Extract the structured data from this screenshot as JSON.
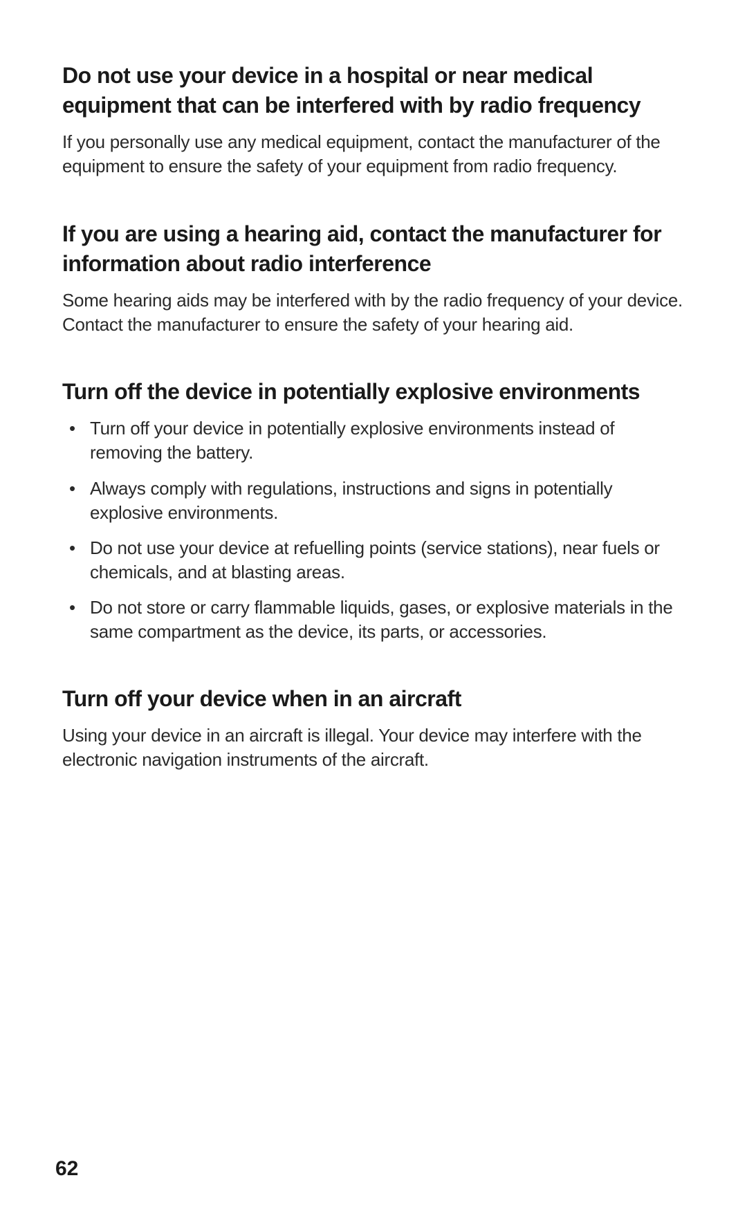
{
  "page_number": "62",
  "sections": [
    {
      "heading": "Do not use your device in a hospital or near medical equipment that can be interfered with by radio frequency",
      "para": "If you personally use any medical equipment, contact the manufacturer of the equipment to ensure the safety of your equipment from radio frequency."
    },
    {
      "heading": "If you are using a hearing aid, contact the manufacturer for information about radio interference",
      "para": "Some hearing aids may be interfered with by the radio frequency of your device. Contact the manufacturer to ensure the safety of your hearing aid."
    },
    {
      "heading": "Turn off the device in potentially explosive environments",
      "bullets": [
        "Turn off your device in potentially explosive environments instead of removing the battery.",
        "Always comply with regulations, instructions and signs in potentially explosive environments.",
        "Do not use your device at refuelling points (service stations), near fuels or chemicals, and at blasting areas.",
        "Do not store or carry flammable liquids, gases, or explosive materials in the same compartment as the device, its parts, or accessories."
      ]
    },
    {
      "heading": "Turn off your device when in an aircraft",
      "para": "Using your device in an aircraft is illegal. Your device may interfere with the electronic navigation instruments of the aircraft."
    }
  ]
}
